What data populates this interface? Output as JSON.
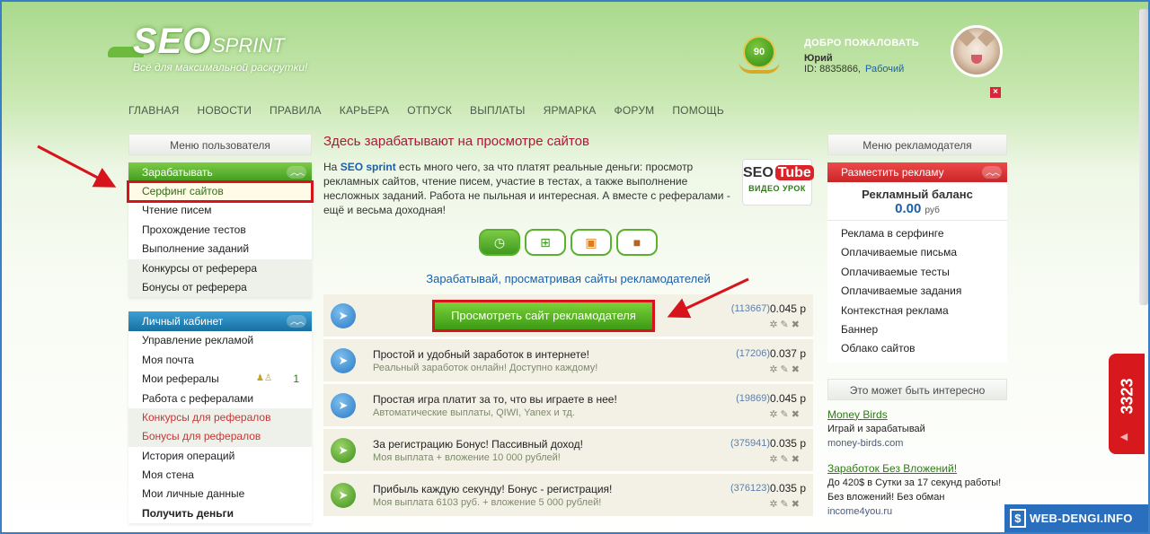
{
  "header": {
    "logo_seo": "SEO",
    "logo_sprint": "SPRINT",
    "tagline": "Всё для максимальной раскрутки!",
    "level": "90",
    "welcome": "ДОБРО ПОЖАЛОВАТЬ",
    "user_name": "Юрий",
    "user_id": "ID: 8835866,",
    "user_status": "Рабочий",
    "close_glyph": "×"
  },
  "nav": [
    "ГЛАВНАЯ",
    "НОВОСТИ",
    "ПРАВИЛА",
    "КАРЬЕРА",
    "ОТПУСК",
    "ВЫПЛАТЫ",
    "ЯРМАРКА",
    "ФОРУМ",
    "ПОМОЩЬ"
  ],
  "left_menu": {
    "title": "Меню пользователя",
    "earn_header": "Зарабатывать",
    "earn_items": [
      "Серфинг сайтов",
      "Чтение писем",
      "Прохождение тестов",
      "Выполнение заданий",
      "Конкурсы от реферера",
      "Бонусы от реферера"
    ],
    "cabinet_header": "Личный кабинет",
    "cabinet_items": [
      "Управление рекламой",
      "Моя почта",
      "Мои рефералы",
      "Работа с рефералами",
      "Конкурсы для рефералов",
      "Бонусы для рефералов",
      "История операций",
      "Моя стена",
      "Мои личные данные",
      "Получить деньги"
    ],
    "referrals_count": "1"
  },
  "center": {
    "title": "Здесь зарабатывают на просмотре сайтов",
    "intro_prefix": "На",
    "intro_brand": "SEO sprint",
    "intro_rest": "есть много чего, за что платят реальные деньги: просмотр рекламных сайтов, чтение писем, участие в тестах, а также выполнение несложных заданий. Работа не пыльная и интересная. А вместе с рефералами - ещё и весьма доходная!",
    "seotube_seo": "SEO",
    "seotube_tube": "Tube",
    "seotube_label": "ВИДЕО УРОК",
    "subtitle": "Зарабатывай, просматривая сайты рекламодателей",
    "view_button": "Просмотреть сайт рекламодателя",
    "rows": [
      {
        "title": "",
        "desc": "",
        "count": "(113667)",
        "price": "0.045 р",
        "color": "blue"
      },
      {
        "title": "Простой и удобный заработок в интернете!",
        "desc": "Реальный заработок онлайн! Доступно каждому!",
        "count": "(17206)",
        "price": "0.037 р",
        "color": "blue"
      },
      {
        "title": "Простая игра платит за то, что вы играете в нее!",
        "desc": "Автоматические выплаты, QIWI, Yanex и тд.",
        "count": "(19869)",
        "price": "0.045 р",
        "color": "blue"
      },
      {
        "title": "За регистрацию Бонус! Пассивный доход!",
        "desc": "Моя выплата + вложение 10 000 рублей!",
        "count": "(375941)",
        "price": "0.035 р",
        "color": "green"
      },
      {
        "title": "Прибыль каждую секунду! Бонус - регистрация!",
        "desc": "Моя выплата 6103 руб. + вложение 5 000 рублей!",
        "count": "(376123)",
        "price": "0.035 р",
        "color": "green"
      }
    ]
  },
  "right_menu": {
    "title": "Меню рекламодателя",
    "place_header": "Разместить рекламу",
    "balance_label": "Рекламный баланс",
    "balance_value": "0.00",
    "balance_unit": "руб",
    "items": [
      "Реклама в серфинге",
      "Оплачиваемые письма",
      "Оплачиваемые тесты",
      "Оплачиваемые задания",
      "Контекстная реклама",
      "Баннер",
      "Облако сайтов"
    ],
    "interest_title": "Это может быть интересно",
    "ads": [
      {
        "title": "Money Birds",
        "desc": "Играй и зарабатывай",
        "url": "money-birds.com"
      },
      {
        "title": "Заработок Без Вложений!",
        "desc": "До 420$ в Сутки за 17 секунд работы! Без вложений! Без обман",
        "url": "income4you.ru"
      }
    ]
  },
  "widget": {
    "counter": "3323"
  },
  "watermark": {
    "dollar": "$",
    "text": "WEB-DENGI.INFO"
  }
}
